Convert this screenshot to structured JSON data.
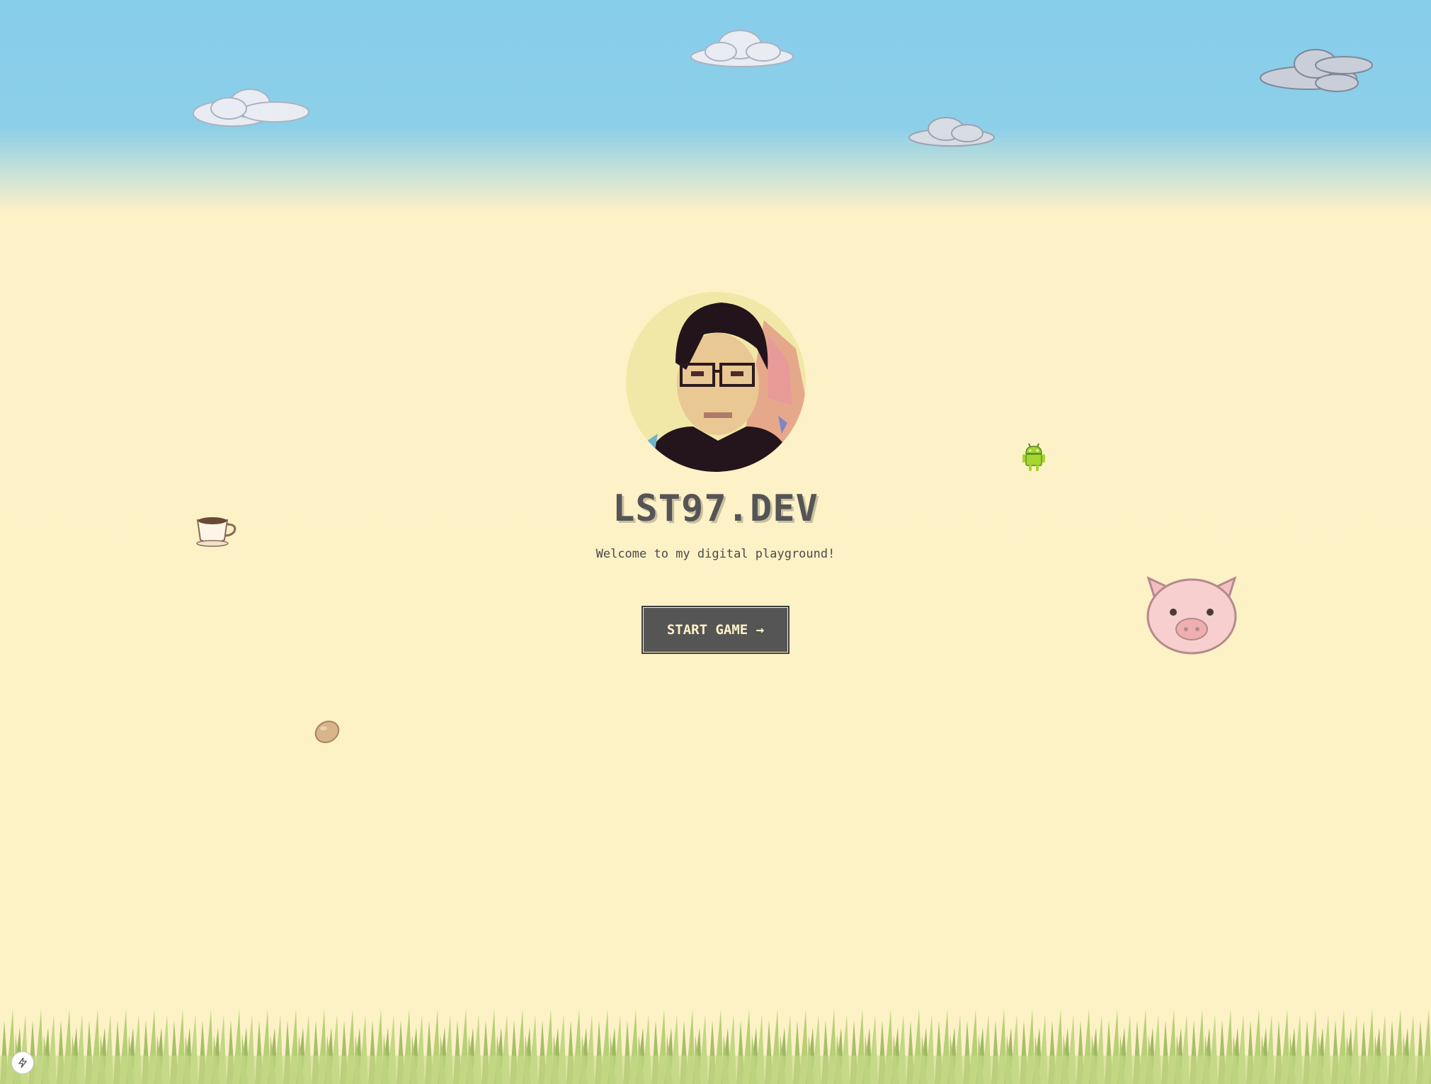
{
  "site": {
    "title": "LST97.DEV",
    "subtitle": "Welcome to my digital playground!"
  },
  "actions": {
    "start_label": "START GAME →"
  },
  "colors": {
    "sky": "#87ceeb",
    "background": "#fdf1c6",
    "button": "#555555",
    "button_text": "#fdf1c6",
    "grass": "#b5c97a"
  },
  "icons": [
    "cloud-icon",
    "coffee-cup-icon",
    "egg-icon",
    "android-icon",
    "pig-icon",
    "lightning-icon"
  ]
}
